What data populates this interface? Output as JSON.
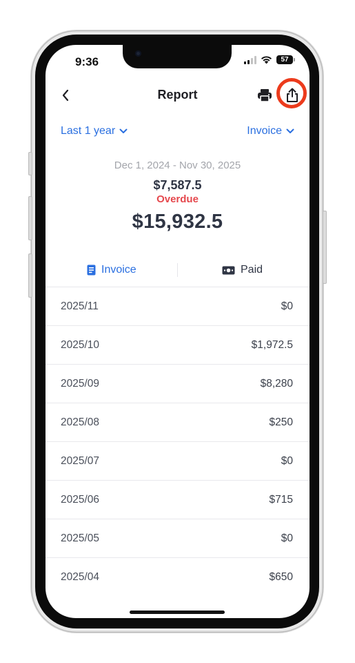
{
  "status": {
    "time": "9:36",
    "battery": "57"
  },
  "nav": {
    "title": "Report"
  },
  "filters": {
    "period": "Last 1 year",
    "type": "Invoice"
  },
  "summary": {
    "date_range": "Dec 1, 2024 - Nov 30, 2025",
    "overdue_amount": "$7,587.5",
    "overdue_label": "Overdue",
    "total": "$15,932.5"
  },
  "tabs": {
    "invoice": "Invoice",
    "paid": "Paid"
  },
  "rows": [
    {
      "period": "2025/11",
      "amount": "$0"
    },
    {
      "period": "2025/10",
      "amount": "$1,972.5"
    },
    {
      "period": "2025/09",
      "amount": "$8,280"
    },
    {
      "period": "2025/08",
      "amount": "$250"
    },
    {
      "period": "2025/07",
      "amount": "$0"
    },
    {
      "period": "2025/06",
      "amount": "$715"
    },
    {
      "period": "2025/05",
      "amount": "$0"
    },
    {
      "period": "2025/04",
      "amount": "$650"
    }
  ],
  "colors": {
    "accent": "#2a6fe0",
    "overdue": "#e5484d",
    "highlight": "#ec3b1c"
  },
  "icons": {
    "back": "chevron-left-icon",
    "print": "printer-icon",
    "share": "share-icon",
    "dropdown": "chevron-down-icon",
    "invoice_tab": "document-icon",
    "paid_tab": "cash-icon"
  }
}
